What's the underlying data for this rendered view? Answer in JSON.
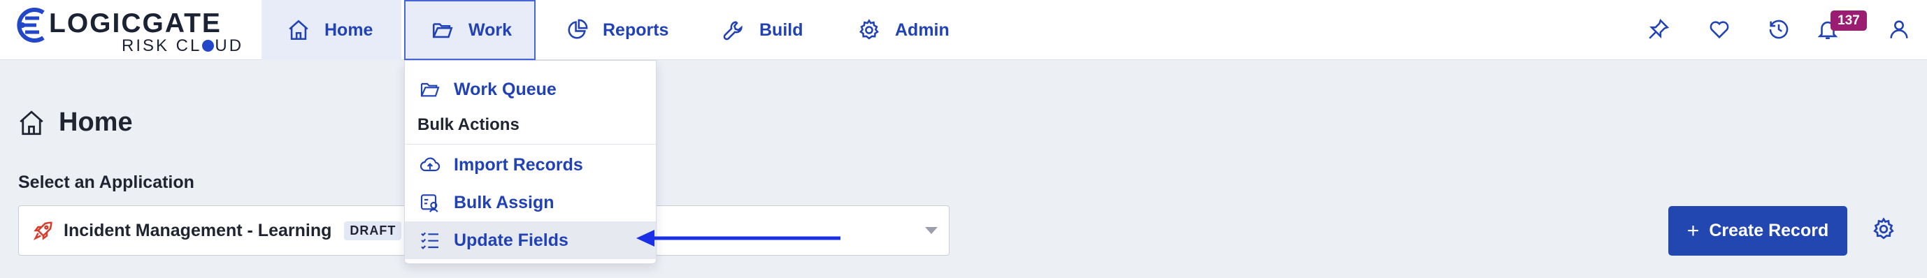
{
  "logo": {
    "name": "LOGICGATE",
    "sub_prefix": "RISK CL",
    "sub_suffix": "UD"
  },
  "nav": {
    "home": "Home",
    "work": "Work",
    "reports": "Reports",
    "build": "Build",
    "admin": "Admin"
  },
  "header_icons": [
    "pin-icon",
    "heart-icon",
    "history-icon",
    "bell-icon",
    "user-icon"
  ],
  "notifications": {
    "count": "137"
  },
  "work_menu": {
    "work_queue": "Work Queue",
    "bulk_actions_header": "Bulk Actions",
    "import_records": "Import Records",
    "bulk_assign": "Bulk Assign",
    "update_fields": "Update Fields"
  },
  "page": {
    "title": "Home",
    "select_label": "Select an Application",
    "selected_app": "Incident Management - Learning",
    "app_status": "DRAFT",
    "create_button": "Create Record"
  },
  "colors": {
    "accent": "#2142b5",
    "button": "#2347b0",
    "badge": "#9a1d72",
    "annotation_arrow": "#1a2fe6"
  }
}
